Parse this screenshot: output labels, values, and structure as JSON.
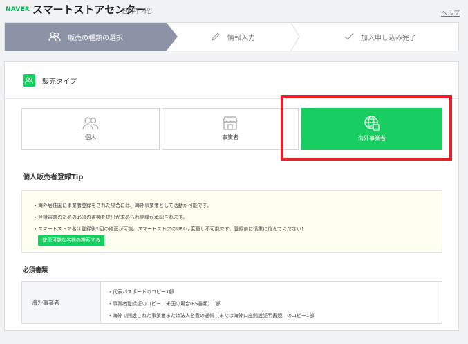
{
  "header": {
    "naver": "NAVER",
    "brand": "スマートストアセンター",
    "subtitle": "판매자 가입",
    "help": "ヘルプ"
  },
  "steps": [
    {
      "label": "販売の種類の選択",
      "icon": "users-icon",
      "active": true
    },
    {
      "label": "情報入力",
      "icon": "pencil-icon",
      "active": false
    },
    {
      "label": "加入申し込み完了",
      "icon": "check-icon",
      "active": false
    }
  ],
  "section": {
    "title": "販売タイプ",
    "icon": "users-icon"
  },
  "seller_types": [
    {
      "label": "個人",
      "icon": "users-icon",
      "selected": false
    },
    {
      "label": "事業者",
      "icon": "store-icon",
      "selected": false
    },
    {
      "label": "海外事業者",
      "icon": "globe-building-icon",
      "selected": true
    }
  ],
  "tip": {
    "title": "個人販売者登録Tip",
    "lines": [
      "・海外居住国に事業者登録をされた場合には、海外事業者として活動が可能です。",
      "・登録審査のための必須の書類を提出が求められ登録が承認されます。",
      "・スマートストア名は登録後1回の修正が可能。スマートストアのURLは変更し不可能です。登録前に慎重に悩んでください！"
    ],
    "button": "使用可能な名前の検索する"
  },
  "required_docs": {
    "title": "必須書類",
    "type": "海外事業者",
    "items": [
      "・代表パスポートのコピー1部",
      "・事業者登録証のコピー（米国の場合IRS書類）1部",
      "・海外で開設された事業者または法人名義の通帳（または海外口座開設証明書類）のコピー1部"
    ]
  },
  "colors": {
    "accent": "#19ce60",
    "step_active": "#8c93a6",
    "highlight": "#e8202a"
  }
}
